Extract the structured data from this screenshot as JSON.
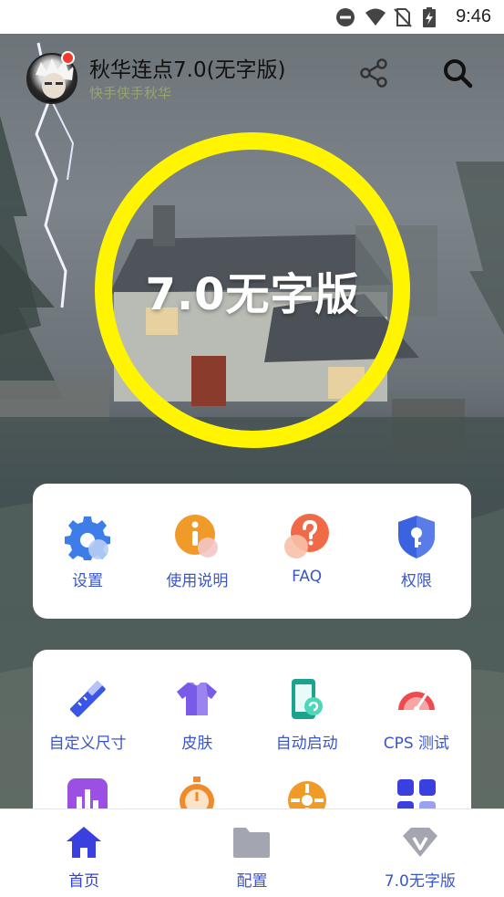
{
  "status_bar": {
    "time": "9:46",
    "icons": [
      "do-not-disturb-icon",
      "wifi-icon",
      "no-sim-icon",
      "battery-charging-icon"
    ]
  },
  "header": {
    "title": "秋华连点7.0(无字版)",
    "subtitle": "快手侠手秋华",
    "actions": [
      "share-icon",
      "search-icon"
    ]
  },
  "hero": {
    "label": "7.0无字版",
    "ring_color": "#fff500"
  },
  "card1": {
    "items": [
      {
        "label": "设置",
        "icon": "gear-icon"
      },
      {
        "label": "使用说明",
        "icon": "info-icon"
      },
      {
        "label": "FAQ",
        "icon": "question-icon"
      },
      {
        "label": "权限",
        "icon": "shield-key-icon"
      }
    ]
  },
  "card2": {
    "items": [
      {
        "label": "自定义尺寸",
        "icon": "ruler-pencil-icon"
      },
      {
        "label": "皮肤",
        "icon": "tshirt-icon"
      },
      {
        "label": "自动启动",
        "icon": "phone-autostart-icon"
      },
      {
        "label": "CPS 测试",
        "icon": "speedometer-icon"
      }
    ],
    "partial_row_icons": [
      "bar-chart-icon",
      "stopwatch-icon",
      "wheel-icon",
      "apps-grid-icon"
    ]
  },
  "bottom_nav": {
    "items": [
      {
        "label": "首页",
        "icon": "home-icon",
        "active": true
      },
      {
        "label": "配置",
        "icon": "folder-icon",
        "active": false
      },
      {
        "label": "7.0无字版",
        "icon": "vip-diamond-icon",
        "active": false
      }
    ]
  },
  "colors": {
    "accent_blue": "#3a56c8",
    "nav_active": "#3140d8",
    "hero_ring": "#fff500",
    "notification_dot": "#f03a2e"
  }
}
